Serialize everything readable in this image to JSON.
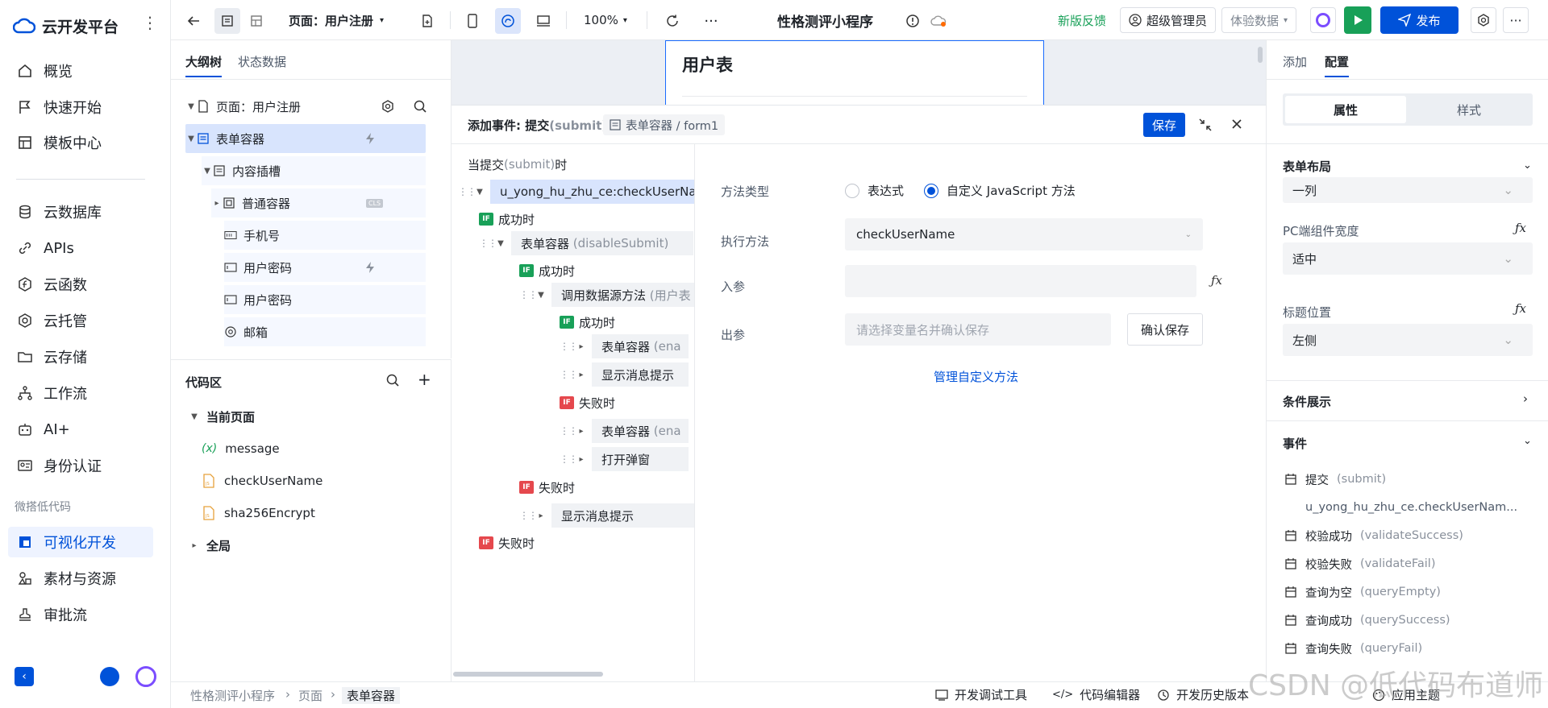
{
  "brand": {
    "title": "云开发平台"
  },
  "nav": {
    "items": [
      {
        "label": "概览"
      },
      {
        "label": "快速开始"
      },
      {
        "label": "模板中心"
      },
      {
        "label": "云数据库"
      },
      {
        "label": "APIs"
      },
      {
        "label": "云函数"
      },
      {
        "label": "云托管"
      },
      {
        "label": "云存储"
      },
      {
        "label": "工作流"
      },
      {
        "label": "AI+"
      },
      {
        "label": "身份认证"
      },
      {
        "label": "可视化开发"
      },
      {
        "label": "素材与资源"
      },
      {
        "label": "审批流"
      }
    ],
    "section_lowcode": "微搭低代码"
  },
  "topbar": {
    "page_select": "页面：用户注册",
    "zoom": "100%",
    "app_title": "性格测评小程序",
    "feedback": "新版反馈",
    "role": "超级管理员",
    "data_mode": "体验数据",
    "publish": "发布"
  },
  "outline": {
    "tabs": [
      "大纲树",
      "状态数据"
    ],
    "nodes": [
      {
        "label": "页面：用户注册"
      },
      {
        "label": "表单容器"
      },
      {
        "label": "内容插槽"
      },
      {
        "label": "普通容器"
      },
      {
        "label": "手机号"
      },
      {
        "label": "用户密码"
      },
      {
        "label": "用户密码"
      },
      {
        "label": "邮箱"
      }
    ]
  },
  "code": {
    "title": "代码区",
    "current_page": "当前页面",
    "items": [
      "message",
      "checkUserName",
      "sha256Encrypt"
    ],
    "global": "全局"
  },
  "canvas": {
    "heading": "用户表"
  },
  "event": {
    "title_prefix": "添加事件: 提交",
    "title_suffix": "(submit)",
    "target": "表单容器 / form1",
    "save": "保存",
    "when_label": "当提交",
    "when_event": "(submit)",
    "when_suffix": "时",
    "flow": {
      "root_action": "u_yong_hu_zhu_ce:checkUserName",
      "on_success": "成功时",
      "disable_submit_name": "表单容器",
      "disable_submit_method": "(disableSubmit)",
      "on_success_2": "成功时",
      "call_ds_name": "调用数据源方法",
      "call_ds_hint": "(用户表",
      "on_success_3": "成功时",
      "form_container_a": "表单容器",
      "form_container_a_hint": "(ena",
      "show_toast": "显示消息提示",
      "on_fail": "失败时",
      "form_container_b": "表单容器",
      "form_container_b_hint": "(ena",
      "open_modal": "打开弹窗",
      "on_fail_2": "失败时",
      "show_toast_2": "显示消息提示",
      "on_fail_3": "失败时"
    },
    "form": {
      "method_type_label": "方法类型",
      "opt_expression": "表达式",
      "opt_custom_js": "自定义 JavaScript 方法",
      "exec_label": "执行方法",
      "exec_value": "checkUserName",
      "param_in_label": "入参",
      "param_out_label": "出参",
      "param_out_placeholder": "请选择变量名并确认保存",
      "confirm_save": "确认保存",
      "manage_link": "管理自定义方法"
    }
  },
  "right": {
    "tabs": [
      "添加",
      "配置"
    ],
    "seg": [
      "属性",
      "样式"
    ],
    "form_layout_title": "表单布局",
    "form_layout_value": "一列",
    "pc_width_label": "PC端组件宽度",
    "pc_width_value": "适中",
    "title_pos_label": "标题位置",
    "title_pos_value": "左侧",
    "cond_title": "条件展示",
    "events_title": "事件",
    "events": [
      {
        "name": "提交",
        "code": "(submit)"
      },
      {
        "name": "u_yong_hu_zhu_ce.checkUserNam...",
        "code": ""
      },
      {
        "name": "校验成功",
        "code": "(validateSuccess)"
      },
      {
        "name": "校验失败",
        "code": "(validateFail)"
      },
      {
        "name": "查询为空",
        "code": "(queryEmpty)"
      },
      {
        "name": "查询成功",
        "code": "(querySuccess)"
      },
      {
        "name": "查询失败",
        "code": "(queryFail)"
      }
    ]
  },
  "bottom": {
    "breadcrumb": [
      "性格测评小程序",
      "页面",
      "表单容器"
    ],
    "tools": [
      "开发调试工具",
      "代码编辑器",
      "开发历史版本",
      "应用主题"
    ]
  },
  "watermark": "CSDN @低代码布道师",
  "colors": {
    "accent": "#0052d9",
    "green": "#18a058",
    "red": "#e5484d",
    "selected": "#d8e4fd"
  }
}
